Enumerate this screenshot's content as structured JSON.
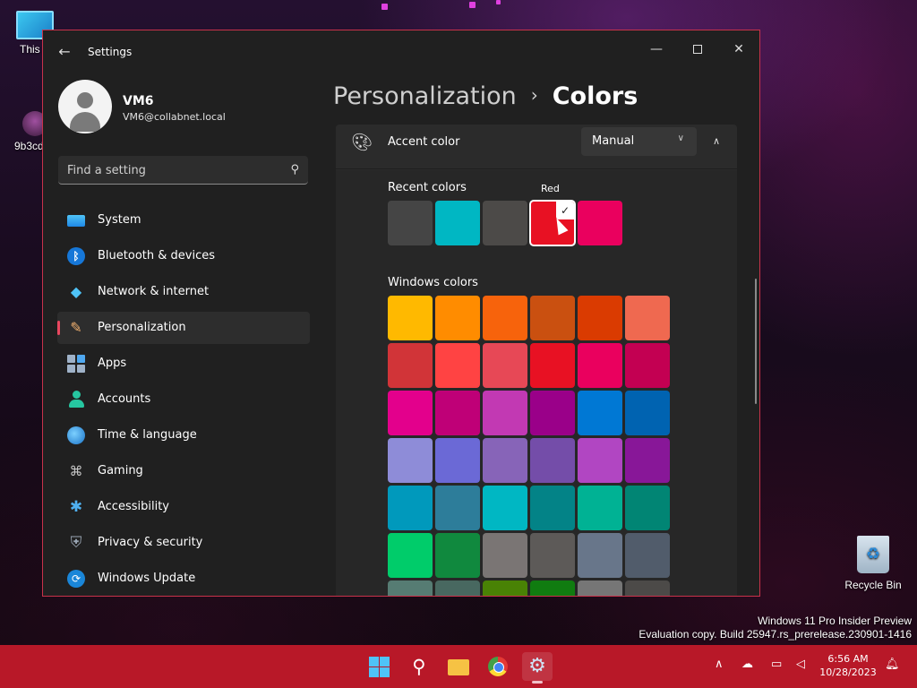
{
  "desktop": {
    "icons": [
      {
        "label": "This P"
      },
      {
        "label": "9b3cdd6"
      },
      {
        "label": "Recycle Bin"
      }
    ],
    "watermark": {
      "line1": "Windows 11 Pro Insider Preview",
      "line2": "Evaluation copy. Build 25947.rs_prerelease.230901-1416"
    }
  },
  "window": {
    "title": "Settings",
    "controls": {
      "minimize": "—",
      "close": "✕"
    }
  },
  "profile": {
    "name": "VM6",
    "email": "VM6@collabnet.local"
  },
  "search": {
    "placeholder": "Find a setting",
    "icon": "search-icon"
  },
  "nav": {
    "items": [
      {
        "label": "System",
        "icon": "system-icon"
      },
      {
        "label": "Bluetooth & devices",
        "icon": "bluetooth-icon"
      },
      {
        "label": "Network & internet",
        "icon": "wifi-icon"
      },
      {
        "label": "Personalization",
        "icon": "brush-icon",
        "active": true
      },
      {
        "label": "Apps",
        "icon": "apps-icon"
      },
      {
        "label": "Accounts",
        "icon": "accounts-icon"
      },
      {
        "label": "Time & language",
        "icon": "globe-icon"
      },
      {
        "label": "Gaming",
        "icon": "gamepad-icon"
      },
      {
        "label": "Accessibility",
        "icon": "accessibility-icon"
      },
      {
        "label": "Privacy & security",
        "icon": "shield-icon"
      },
      {
        "label": "Windows Update",
        "icon": "update-icon"
      }
    ]
  },
  "breadcrumb": {
    "parent": "Personalization",
    "separator": "›",
    "current": "Colors"
  },
  "accent": {
    "label": "Accent color",
    "mode": "Manual",
    "icon": "palette-icon"
  },
  "recent_colors": {
    "label": "Recent colors",
    "hover_tip": "Red",
    "selected_index": 3,
    "colors": [
      "#454545",
      "#00b7c3",
      "#4c4a48",
      "#e81123",
      "#ea005e"
    ]
  },
  "windows_colors": {
    "label": "Windows colors",
    "rows": [
      [
        "#ffb900",
        "#ff8c00",
        "#f7630c",
        "#ca5010",
        "#da3b01",
        "#ef6950"
      ],
      [
        "#d13438",
        "#ff4343",
        "#e74856",
        "#e81123",
        "#ea005e",
        "#c30052"
      ],
      [
        "#e3008c",
        "#bf0077",
        "#c239b3",
        "#9a0089",
        "#0078d4",
        "#0063b1"
      ],
      [
        "#8e8cd8",
        "#6b69d6",
        "#8764b8",
        "#744da9",
        "#b146c2",
        "#881798"
      ],
      [
        "#0099bc",
        "#2d7d9a",
        "#00b7c3",
        "#038387",
        "#00b294",
        "#018574"
      ],
      [
        "#00cc6a",
        "#10893e",
        "#7a7574",
        "#5d5a58",
        "#68768a",
        "#515c6b"
      ],
      [
        "#567c73",
        "#486860",
        "#498205",
        "#107c10",
        "#767676",
        "#4c4a48"
      ]
    ]
  },
  "taskbar": {
    "apps": [
      "start-icon",
      "search-icon",
      "file-explorer-icon",
      "chrome-icon",
      "settings-icon"
    ],
    "clock": {
      "time": "6:56 AM",
      "date": "10/28/2023"
    }
  },
  "colors": {
    "accent_red": "#e81123",
    "taskbar": "#b81828",
    "window_bg": "#202020"
  }
}
